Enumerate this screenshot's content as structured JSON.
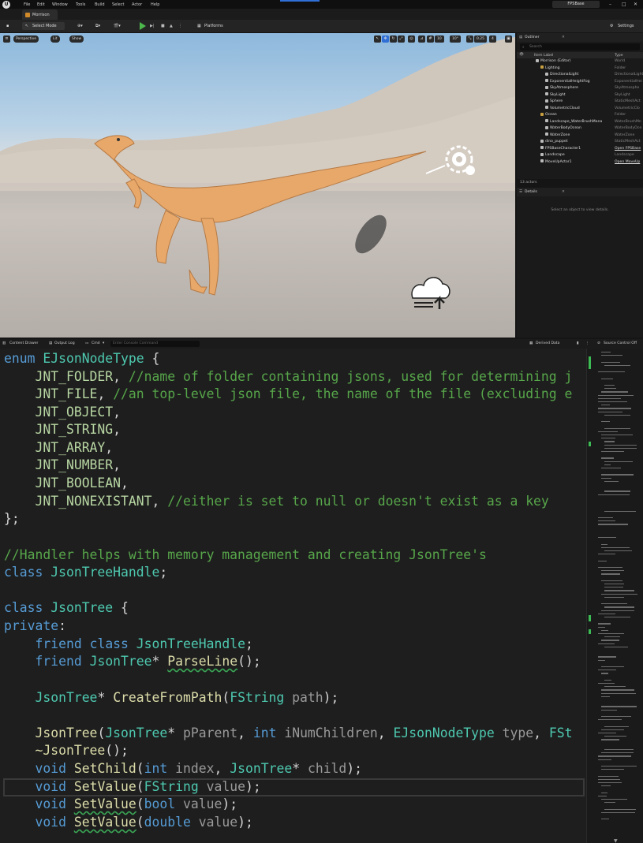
{
  "menubar": {
    "logo": "U",
    "items": [
      "File",
      "Edit",
      "Window",
      "Tools",
      "Build",
      "Select",
      "Actor",
      "Help"
    ],
    "project": "FPSBase",
    "window_buttons": [
      "–",
      "□",
      "✕"
    ]
  },
  "tab": {
    "map_name": "Morrison"
  },
  "toolbar": {
    "select_mode": "Select Mode",
    "platforms": "Platforms",
    "settings": "Settings"
  },
  "viewport": {
    "perspective": "Perspective",
    "lit": "Lit",
    "show": "Show",
    "grid_snap": "10",
    "rot_snap": "10°",
    "scale_snap": "0.25",
    "camera_speed": "4"
  },
  "outliner": {
    "title": "Outliner",
    "search_placeholder": "Search",
    "col_label": "Item Label",
    "col_type": "Type",
    "rows": [
      {
        "label": "Morrison (Editor)",
        "type": "World",
        "indent": 0
      },
      {
        "label": "Lighting",
        "type": "Folder",
        "indent": 1,
        "folder": true
      },
      {
        "label": "DirectionalLight",
        "type": "DirectionalLight",
        "indent": 2
      },
      {
        "label": "ExponentialHeightFog",
        "type": "ExponentialHei",
        "indent": 2
      },
      {
        "label": "SkyAtmosphere",
        "type": "SkyAtmosphe",
        "indent": 2
      },
      {
        "label": "SkyLight",
        "type": "SkyLight",
        "indent": 2
      },
      {
        "label": "Sphere",
        "type": "StaticMeshAct",
        "indent": 2
      },
      {
        "label": "VolumetricCloud",
        "type": "VolumetricClo",
        "indent": 2
      },
      {
        "label": "Ocean",
        "type": "Folder",
        "indent": 1,
        "folder": true
      },
      {
        "label": "Landscape_WaterBrushMana",
        "type": "WaterBrushMn",
        "indent": 2
      },
      {
        "label": "WaterBodyOcean",
        "type": "WaterBodyOce",
        "indent": 2
      },
      {
        "label": "WaterZone",
        "type": "WaterZone",
        "indent": 2
      },
      {
        "label": "dino_puppet",
        "type": "StaticMeshAct",
        "indent": 1
      },
      {
        "label": "FPSBaseCharacter1",
        "type": "Open FPSBase",
        "indent": 1,
        "link": true
      },
      {
        "label": "Landscape",
        "type": "Landscape",
        "indent": 1
      },
      {
        "label": "MoveUpActor1",
        "type": "Open MoveUp",
        "indent": 1,
        "link": true
      }
    ],
    "actor_count": "13 actors"
  },
  "details": {
    "title": "Details",
    "empty_text": "Select an object to view details."
  },
  "statusbar": {
    "content_drawer": "Content Drawer",
    "output_log": "Output Log",
    "cmd": "Cmd",
    "console_placeholder": "Enter Console Command",
    "derived_data": "Derived Data",
    "source_control": "Source Control Off"
  },
  "code": {
    "l1_enum": "enum",
    "l1_name": "EJsonNodeType",
    "l1_brace": " {",
    "l2_name": "JNT_FOLDER",
    "l2_comment": "//name of folder containing jsons, used for determining j",
    "l3_name": "JNT_FILE",
    "l3_comment": "//an top-level json file, the name of the file (excluding e",
    "l4_name": "JNT_OBJECT",
    "l5_name": "JNT_STRING",
    "l6_name": "JNT_ARRAY",
    "l7_name": "JNT_NUMBER",
    "l8_name": "JNT_BOOLEAN",
    "l9_name": "JNT_NONEXISTANT",
    "l9_comment": "//either is set to null or doesn't exist as a key",
    "l10_close": "};",
    "l11_comment": "//Handler helps with memory management and creating JsonTree's",
    "l12_class": "class",
    "l12_name": "JsonTreeHandle",
    "l13_class": "class",
    "l13_name": "JsonTree",
    "l14_private": "private",
    "l15_friend": "friend",
    "l15_class": "class",
    "l15_name": "JsonTreeHandle",
    "l16_friend": "friend",
    "l16_type": "JsonTree",
    "l16_fn": "ParseLine",
    "l17_type": "JsonTree",
    "l17_fn": "CreateFromPath",
    "l17_ptype": "FString",
    "l17_param": "path",
    "l18_fn": "JsonTree",
    "l18_t1": "JsonTree",
    "l18_p1": "pParent",
    "l18_kw": "int",
    "l18_p2": "iNumChildren",
    "l18_t3": "EJsonNodeType",
    "l18_p3": "type",
    "l18_t4": "FSt",
    "l19_fn": "~JsonTree",
    "l20_void": "void",
    "l20_fn": "SetChild",
    "l20_kw": "int",
    "l20_p1": "index",
    "l20_t2": "JsonTree",
    "l20_p2": "child",
    "l21_void": "void",
    "l21_fn": "SetValue",
    "l21_type": "FString",
    "l21_param": "value",
    "l22_void": "void",
    "l22_fn": "SetValue",
    "l22_type": "bool",
    "l22_param": "value",
    "l23_void": "void",
    "l23_fn": "SetValue",
    "l23_type": "double",
    "l23_param": "value"
  }
}
